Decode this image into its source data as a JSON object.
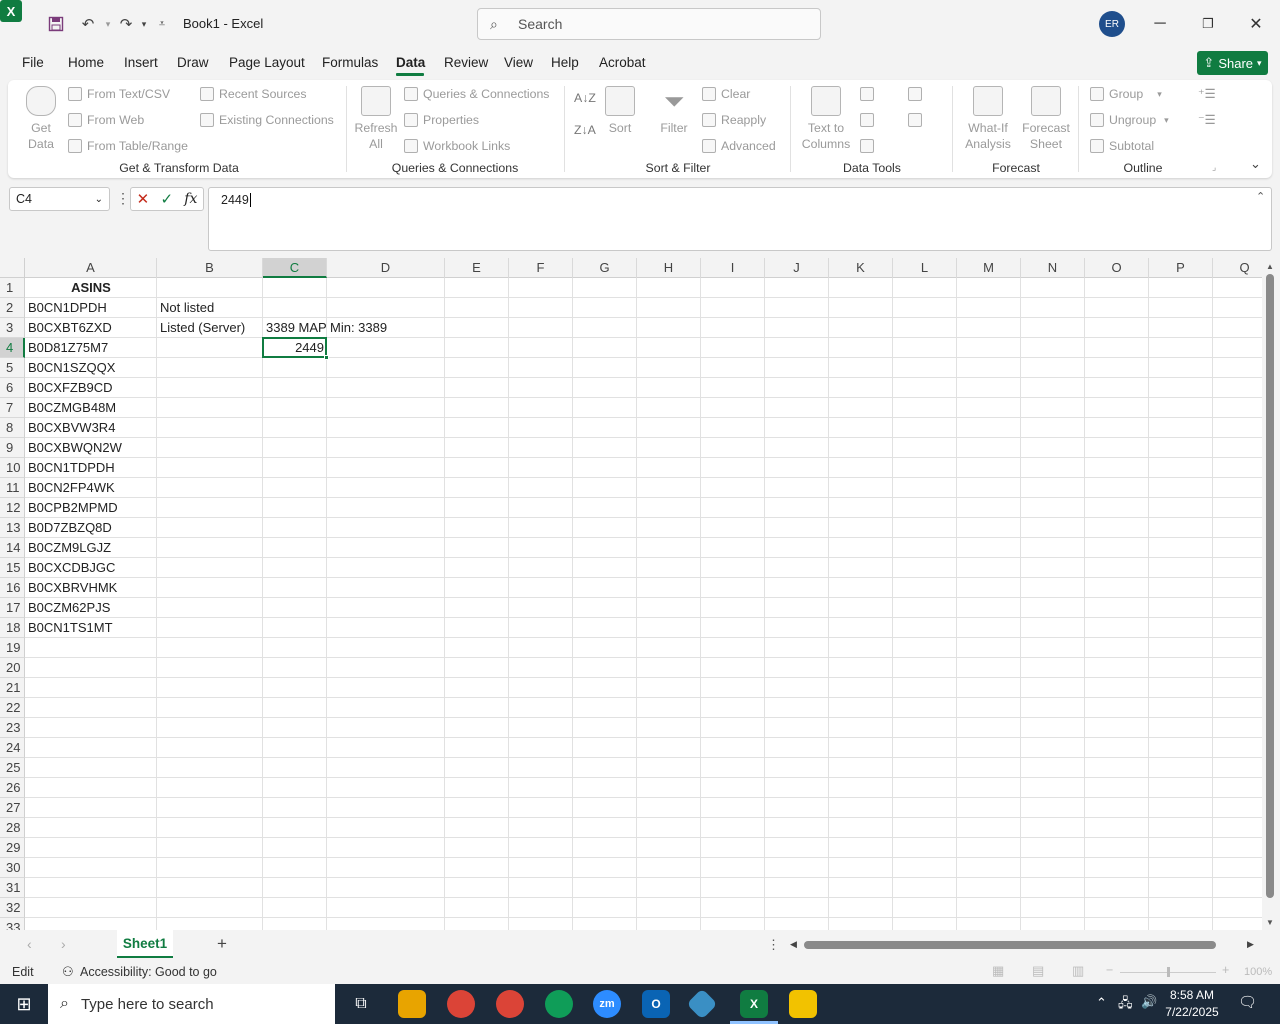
{
  "window": {
    "title": "Book1  -  Excel",
    "search_placeholder": "Search",
    "user_initials": "ER",
    "share_label": "Share"
  },
  "menu": [
    "File",
    "Home",
    "Insert",
    "Draw",
    "Page Layout",
    "Formulas",
    "Data",
    "Review",
    "View",
    "Help",
    "Acrobat"
  ],
  "menu_active": "Data",
  "ribbon": {
    "get_data": "Get Data",
    "from_text_csv": "From Text/CSV",
    "from_web": "From Web",
    "from_table_range": "From Table/Range",
    "recent_sources": "Recent Sources",
    "existing_connections": "Existing Connections",
    "group1_label": "Get & Transform Data",
    "refresh_all": "Refresh All",
    "queries_connections": "Queries & Connections",
    "properties": "Properties",
    "workbook_links": "Workbook Links",
    "group2_label": "Queries & Connections",
    "sort_az": "A↓Z",
    "sort_za": "Z↓A",
    "sort": "Sort",
    "filter": "Filter",
    "clear": "Clear",
    "reapply": "Reapply",
    "advanced": "Advanced",
    "group3_label": "Sort & Filter",
    "text_to_columns": "Text to Columns",
    "group4_label": "Data Tools",
    "what_if": "What-If Analysis",
    "forecast_sheet": "Forecast Sheet",
    "group5_label": "Forecast",
    "group_btn": "Group",
    "ungroup_btn": "Ungroup",
    "subtotal_btn": "Subtotal",
    "group6_label": "Outline"
  },
  "formula_bar": {
    "name_box": "C4",
    "formula": "2449"
  },
  "columns": [
    "A",
    "B",
    "C",
    "D",
    "E",
    "F",
    "G",
    "H",
    "I",
    "J",
    "K",
    "L",
    "M",
    "N",
    "O",
    "P",
    "Q"
  ],
  "rows": [
    "1",
    "2",
    "3",
    "4",
    "5",
    "6",
    "7",
    "8",
    "9",
    "10",
    "11",
    "12",
    "13",
    "14",
    "15",
    "16",
    "17",
    "18",
    "19",
    "20",
    "21",
    "22",
    "23",
    "24",
    "25",
    "26",
    "27",
    "28",
    "29",
    "30",
    "31",
    "32",
    "33"
  ],
  "cells": {
    "A1": "ASINS",
    "A2": "B0CN1DPDH",
    "A3": "B0CXBT6ZXD",
    "A4": "B0D81Z75M7",
    "A5": "B0CN1SZQQX",
    "A6": "B0CXFZB9CD",
    "A7": "B0CZMGB48M",
    "A8": "B0CXBVW3R4",
    "A9": "B0CXBWQN2W",
    "A10": "B0CN1TDPDH",
    "A11": "B0CN2FP4WK",
    "A12": "B0CPB2MPMD",
    "A13": "B0D7ZBZQ8D",
    "A14": "B0CZM9LGJZ",
    "A15": "B0CXCDBJGC",
    "A16": "B0CXBRVHMK",
    "A17": "B0CZM62PJS",
    "A18": "B0CN1TS1MT",
    "B2": "Not listed",
    "B3": "Listed (Server)",
    "C3": "3389 MAP",
    "D3": "Min: 3389",
    "C4": "2449"
  },
  "sheet_tab": "Sheet1",
  "status": {
    "mode": "Edit",
    "accessibility": "Accessibility: Good to go",
    "zoom": "100%"
  },
  "taskbar": {
    "search_placeholder": "Type here to search",
    "time": "8:58 AM",
    "date": "7/22/2025"
  }
}
